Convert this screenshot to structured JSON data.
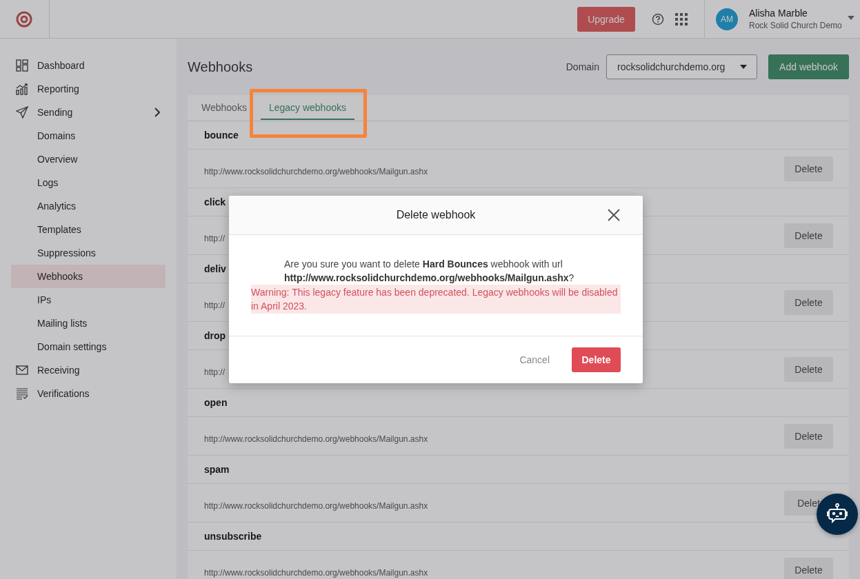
{
  "header": {
    "upgrade_button": "Upgrade",
    "user": {
      "initials": "AM",
      "name": "Alisha Marble",
      "org": "Rock Solid Church Demo"
    }
  },
  "sidebar": {
    "items": [
      {
        "label": "Dashboard",
        "selected": false
      },
      {
        "label": "Reporting",
        "selected": false
      },
      {
        "label": "Sending",
        "selected": false,
        "children": [
          {
            "label": "Domains",
            "selected": false
          },
          {
            "label": "Overview",
            "selected": false
          },
          {
            "label": "Logs",
            "selected": false
          },
          {
            "label": "Analytics",
            "selected": false
          },
          {
            "label": "Templates",
            "selected": false
          },
          {
            "label": "Suppressions",
            "selected": false
          },
          {
            "label": "Webhooks",
            "selected": true
          },
          {
            "label": "IPs",
            "selected": false
          },
          {
            "label": "Mailing lists",
            "selected": false
          },
          {
            "label": "Domain settings",
            "selected": false
          }
        ]
      },
      {
        "label": "Receiving",
        "selected": false
      },
      {
        "label": "Verifications",
        "selected": false
      }
    ]
  },
  "page": {
    "title": "Webhooks",
    "domain_label": "Domain",
    "domain_value": "rocksolidchurchdemo.org",
    "add_button": "Add webhook",
    "tabs": [
      {
        "label": "Webhooks",
        "selected": false
      },
      {
        "label": "Legacy webhooks",
        "selected": true
      }
    ],
    "webhooks": [
      {
        "name": "bounce",
        "url": "http://www.rocksolidchurchdemo.org/webhooks/Mailgun.ashx",
        "button": "Delete"
      },
      {
        "name": "click",
        "url": "http://",
        "button": "Delete"
      },
      {
        "name": "deliv",
        "url": "http://",
        "button": "Delete"
      },
      {
        "name": "drop",
        "url": "http://",
        "button": "Delete"
      },
      {
        "name": "open",
        "url": "http://www.rocksolidchurchdemo.org/webhooks/Mailgun.ashx",
        "button": "Delete"
      },
      {
        "name": "spam",
        "url": "http://www.rocksolidchurchdemo.org/webhooks/Mailgun.ashx",
        "button": "Delet"
      },
      {
        "name": "unsubscribe",
        "url": "http://www.rocksolidchurchdemo.org/webhooks/Mailgun.ashx",
        "button": "Delete"
      }
    ]
  },
  "modal": {
    "title": "Delete webhook",
    "message": "Are you sure you want to delete **Hard Bounces** webhook with url **http://www.rocksolidchurchdemo.org/webhooks/Mailgun.ashx**?",
    "warning": "Warning: This legacy feature has been deprecated. Legacy webhooks will be disabled in April 2023.",
    "cancel": "Cancel",
    "confirm": "Delete"
  }
}
